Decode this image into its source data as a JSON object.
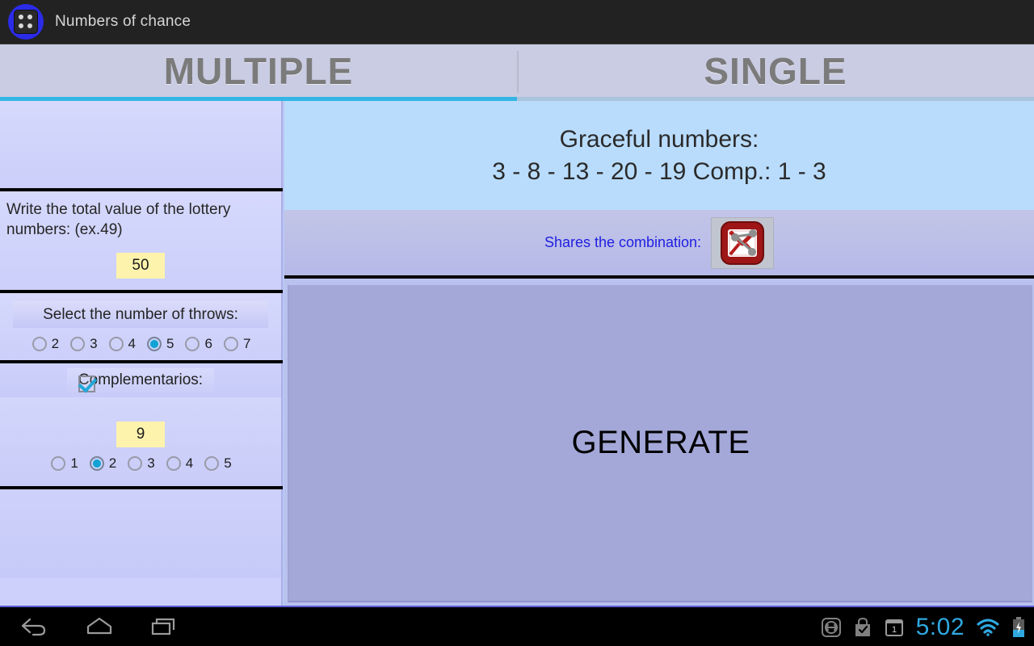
{
  "titlebar": {
    "app_name": "Numbers of chance",
    "icon": "dice-icon"
  },
  "tabs": [
    {
      "label": "MULTIPLE",
      "active": true
    },
    {
      "label": "SINGLE",
      "active": false
    }
  ],
  "left_panel": {
    "total_value": {
      "prompt": "Write the total value of the lottery numbers: (ex.49)",
      "value": "50"
    },
    "throws": {
      "label": "Select the number of throws:",
      "options": [
        "2",
        "3",
        "4",
        "5",
        "6",
        "7"
      ],
      "selected": "5"
    },
    "complementary": {
      "label": "Complementarios:",
      "checked": true,
      "value": "9",
      "options": [
        "1",
        "2",
        "3",
        "4",
        "5"
      ],
      "selected": "2"
    }
  },
  "right_panel": {
    "result_title": "Graceful numbers:",
    "result_numbers": "3 - 8 - 13 - 20 - 19 Comp.: 1 - 3",
    "share_label": "Shares the combination:",
    "share_icon": "share-mail-icon",
    "generate_label": "GENERATE"
  },
  "navbar": {
    "back": "back-icon",
    "home": "home-icon",
    "recents": "recents-icon",
    "status": {
      "sync": "sync-arrows-icon",
      "bag": "shopping-bag-check-icon",
      "badge": "1",
      "time": "5:02",
      "wifi": "wifi-icon",
      "battery": "battery-charging-icon"
    }
  },
  "colors": {
    "accent": "#33b5e5",
    "titlebar_bg": "#222222",
    "panel_bg": "#d3d6fa",
    "result_bg": "#b9dcfd",
    "field_yellow": "#fdf3ad",
    "generate_bg": "#a3a8d8",
    "share_text": "#2020e0",
    "clock": "#2fa8e0"
  }
}
